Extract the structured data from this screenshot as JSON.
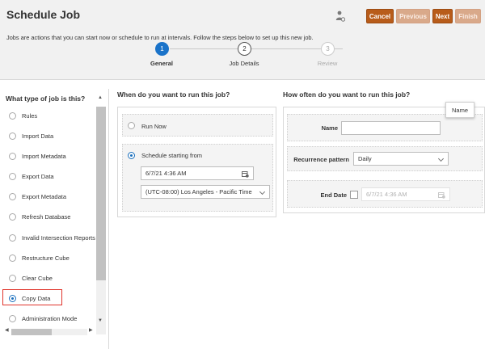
{
  "header": {
    "title": "Schedule Job",
    "intro": "Jobs are actions that you can start now or schedule to run at intervals. Follow the steps below to set up this new job.",
    "buttons": {
      "cancel": "Cancel",
      "previous": "Previous",
      "next": "Next",
      "finish": "Finish"
    },
    "user_icon": "user-settings-icon"
  },
  "steps": [
    {
      "number": "1",
      "label": "General",
      "state": "active"
    },
    {
      "number": "2",
      "label": "Job Details",
      "state": "pending"
    },
    {
      "number": "3",
      "label": "Review",
      "state": "disabled"
    }
  ],
  "job_types": {
    "title": "What type of job is this?",
    "items": [
      {
        "label": "Rules",
        "selected": false
      },
      {
        "label": "Import Data",
        "selected": false
      },
      {
        "label": "Import Metadata",
        "selected": false
      },
      {
        "label": "Export Data",
        "selected": false
      },
      {
        "label": "Export Metadata",
        "selected": false
      },
      {
        "label": "Refresh Database",
        "selected": false
      },
      {
        "label": "Invalid Intersection Reports",
        "selected": false
      },
      {
        "label": "Restructure Cube",
        "selected": false
      },
      {
        "label": "Clear Cube",
        "selected": false
      },
      {
        "label": "Copy Data",
        "selected": true
      },
      {
        "label": "Administration Mode",
        "selected": false
      }
    ]
  },
  "when": {
    "title": "When do you want to run this job?",
    "run_now": "Run Now",
    "schedule": "Schedule starting from",
    "selected": "schedule",
    "date_value": "6/7/21 4:36 AM",
    "timezone_value": "(UTC-08:00) Los Angeles - Pacific Time"
  },
  "how_often": {
    "title": "How often do you want to run this job?",
    "name_label": "Name",
    "name_value": "",
    "name_tooltip": "Name",
    "recurrence_label": "Recurrence pattern",
    "recurrence_value": "Daily",
    "end_date_label": "End Date",
    "end_date_value": "6/7/21 4:36 AM"
  },
  "colors": {
    "primary_button": "#b85c1a",
    "disabled_button": "#d9a98a",
    "active_step": "#1a73c9",
    "highlight": "#e0342b"
  }
}
